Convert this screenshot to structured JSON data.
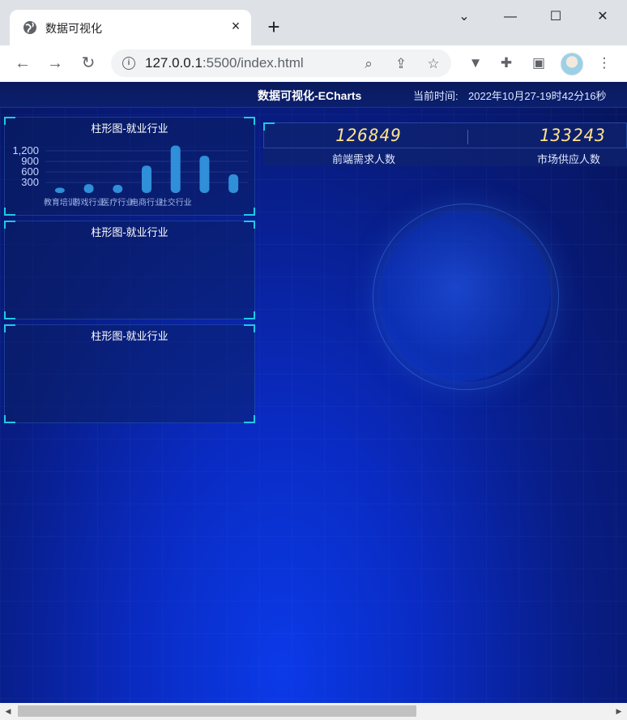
{
  "browser": {
    "tab_title": "数据可视化",
    "tab_close": "×",
    "new_tab": "+",
    "url_host": "127.0.0.1",
    "url_rest": ":5500/index.html",
    "window_controls": {
      "dropdown": "⌄",
      "minimize": "—",
      "maximize": "☐",
      "close": "✕"
    },
    "nav": {
      "back": "←",
      "forward": "→",
      "reload": "↻"
    }
  },
  "header": {
    "title": "数据可视化-ECharts",
    "time_label": "当前时间:",
    "time_value": "2022年10月27-19时42分16秒"
  },
  "stats": [
    {
      "value": "126849",
      "label": "前端需求人数"
    },
    {
      "value": "133243",
      "label": "市场供应人数"
    }
  ],
  "panels": [
    {
      "title": "柱形图-就业行业"
    },
    {
      "title": "柱形图-就业行业"
    },
    {
      "title": "柱形图-就业行业"
    }
  ],
  "chart_data": {
    "type": "bar",
    "title": "柱形图-就业行业",
    "categories": [
      "教育培训",
      "游戏行业",
      "医疗行业",
      "电商行业",
      "社交行业",
      "",
      ""
    ],
    "category_labels_shown": [
      "教育培训",
      "游戏行业",
      "医疗行业",
      "电商行业",
      "社交行业"
    ],
    "values": [
      150,
      250,
      230,
      780,
      1350,
      1060,
      530
    ],
    "ytick_labels": [
      "1,200",
      "900",
      "600",
      "300"
    ],
    "ylim": [
      0,
      1500
    ],
    "bar_color": "#2f8fd8",
    "grid": true
  },
  "colors": {
    "accent_corner": "#1fc9e6",
    "stat_number": "#ffe28a"
  }
}
